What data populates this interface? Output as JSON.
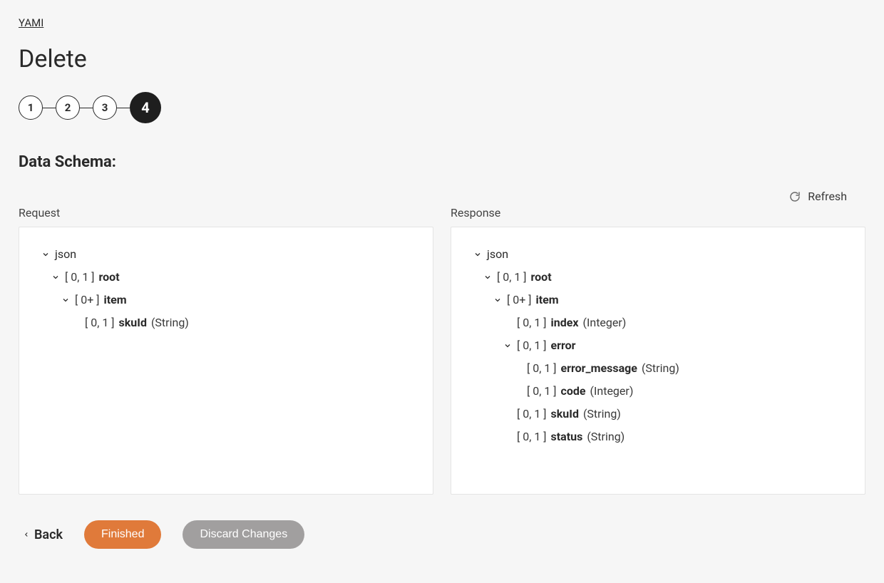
{
  "breadcrumb": {
    "root": "YAMI"
  },
  "page": {
    "title": "Delete"
  },
  "stepper": {
    "steps": [
      "1",
      "2",
      "3",
      "4"
    ],
    "active_index": 3
  },
  "section": {
    "heading": "Data Schema:"
  },
  "refresh": {
    "label": "Refresh"
  },
  "columns": {
    "request_label": "Request",
    "response_label": "Response"
  },
  "request_tree": {
    "root": "json",
    "row1_card": "[ 0, 1 ]",
    "row1_name": "root",
    "row2_card": "[ 0+ ]",
    "row2_name": "item",
    "row3_card": "[ 0, 1 ]",
    "row3_name": "skuId",
    "row3_type": "(String)"
  },
  "response_tree": {
    "root": "json",
    "row1_card": "[ 0, 1 ]",
    "row1_name": "root",
    "row2_card": "[ 0+ ]",
    "row2_name": "item",
    "row3_card": "[ 0, 1 ]",
    "row3_name": "index",
    "row3_type": "(Integer)",
    "row4_card": "[ 0, 1 ]",
    "row4_name": "error",
    "row5_card": "[ 0, 1 ]",
    "row5_name": "error_message",
    "row5_type": "(String)",
    "row6_card": "[ 0, 1 ]",
    "row6_name": "code",
    "row6_type": "(Integer)",
    "row7_card": "[ 0, 1 ]",
    "row7_name": "skuId",
    "row7_type": "(String)",
    "row8_card": "[ 0, 1 ]",
    "row8_name": "status",
    "row8_type": "(String)"
  },
  "footer": {
    "back": "Back",
    "finished": "Finished",
    "discard": "Discard Changes"
  }
}
